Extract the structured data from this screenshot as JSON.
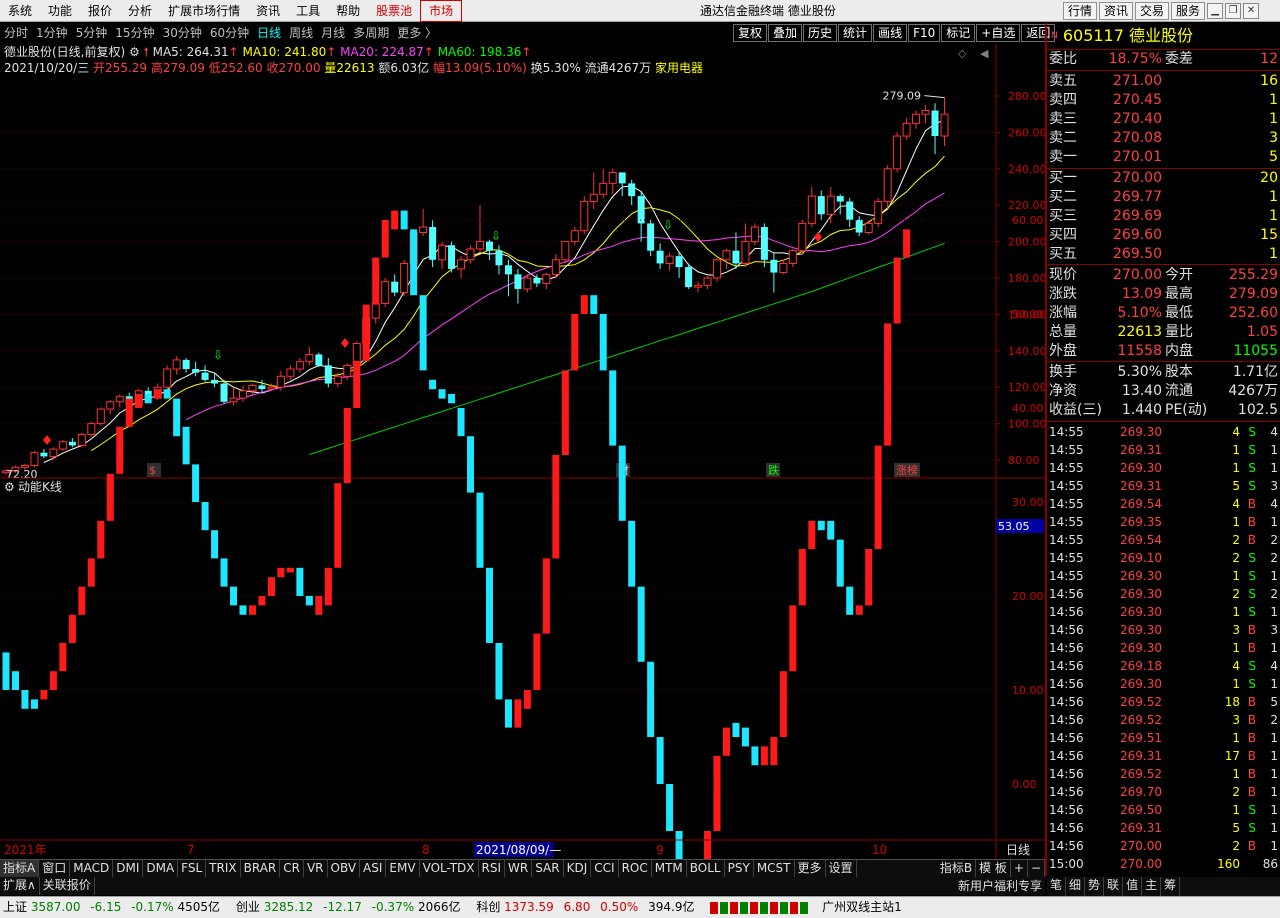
{
  "menu": [
    "系统",
    "功能",
    "报价",
    "分析",
    "扩展市场行情",
    "资讯",
    "工具",
    "帮助",
    "股票池",
    "市场"
  ],
  "app_title": "通达信金融终端  德业股份",
  "right_buttons": [
    "行情",
    "资讯",
    "交易",
    "服务"
  ],
  "periods": [
    "分时",
    "1分钟",
    "5分钟",
    "15分钟",
    "30分钟",
    "60分钟",
    "日线",
    "周线",
    "月线",
    "多周期",
    "更多 〉"
  ],
  "tool_buttons": [
    "复权",
    "叠加",
    "历史",
    "统计",
    "画线",
    "F10",
    "标记",
    "+自选",
    "返回"
  ],
  "info1": {
    "name": "德业股份(日线,前复权)",
    "ma5": "MA5: 264.31",
    "ma10": "MA10: 241.80",
    "ma20": "MA20: 224.87",
    "ma60": "MA60: 198.36"
  },
  "info2": {
    "date": "2021/10/20/三",
    "open": "开255.29",
    "high": "高279.09",
    "low": "低252.60",
    "close": "收270.00",
    "vol": "量22613",
    "amt": "额6.03亿",
    "chg": "幅13.09(5.10%)",
    "turn": "换5.30%",
    "float": "流通4267万",
    "ind": "家用电器"
  },
  "kchart": {
    "y_ticks": [
      "280.00",
      "260.00",
      "240.00",
      "220.00",
      "200.00",
      "180.00",
      "160.00",
      "140.00",
      "120.00",
      "100.00",
      "80.00"
    ],
    "high_label": "279.09",
    "low_label": "72.20",
    "markers": [
      "$",
      "财",
      "跌",
      "涨榜"
    ]
  },
  "indicator": {
    "title": "动能K线",
    "y_ticks": [
      "60.00",
      "50.00",
      "40.00",
      "30.00",
      "20.00",
      "10.00",
      "0.00"
    ],
    "last_value": "53.05"
  },
  "x_axis": {
    "labels": [
      "2021年",
      "7",
      "8",
      "9",
      "10"
    ],
    "cursor_label": "2021/08/09/—",
    "right_label": "日线"
  },
  "stock": {
    "flag": "N",
    "code": "605117",
    "name": "德业股份"
  },
  "weibi": {
    "l1": "委比",
    "v1": "18.75%",
    "l2": "委差",
    "v2": "12"
  },
  "asks": [
    {
      "label": "卖五",
      "price": "271.00",
      "vol": "16"
    },
    {
      "label": "卖四",
      "price": "270.45",
      "vol": "1"
    },
    {
      "label": "卖三",
      "price": "270.40",
      "vol": "1"
    },
    {
      "label": "卖二",
      "price": "270.08",
      "vol": "3"
    },
    {
      "label": "卖一",
      "price": "270.01",
      "vol": "5"
    }
  ],
  "bids": [
    {
      "label": "买一",
      "price": "270.00",
      "vol": "20"
    },
    {
      "label": "买二",
      "price": "269.77",
      "vol": "1"
    },
    {
      "label": "买三",
      "price": "269.69",
      "vol": "1"
    },
    {
      "label": "买四",
      "price": "269.60",
      "vol": "15"
    },
    {
      "label": "买五",
      "price": "269.50",
      "vol": "1"
    }
  ],
  "quote1": [
    {
      "l1": "现价",
      "v1": "270.00",
      "l2": "今开",
      "v2": "255.29"
    },
    {
      "l1": "涨跌",
      "v1": "13.09",
      "l2": "最高",
      "v2": "279.09"
    },
    {
      "l1": "涨幅",
      "v1": "5.10%",
      "l2": "最低",
      "v2": "252.60"
    },
    {
      "l1": "总量",
      "v1": "22613",
      "l2": "量比",
      "v2": "1.05"
    },
    {
      "l1": "外盘",
      "v1": "11558",
      "l2": "内盘",
      "v2": "11055"
    }
  ],
  "quote2": [
    {
      "l1": "换手",
      "v1": "5.30%",
      "l2": "股本",
      "v2": "1.71亿"
    },
    {
      "l1": "净资",
      "v1": "13.40",
      "l2": "流通",
      "v2": "4267万"
    },
    {
      "l1": "收益(三)",
      "v1": "1.440",
      "l2": "PE(动)",
      "v2": "102.5"
    }
  ],
  "ticks": [
    {
      "t": "14:55",
      "p": "269.30",
      "v": "4",
      "s": "S",
      "n": "4"
    },
    {
      "t": "14:55",
      "p": "269.31",
      "v": "1",
      "s": "S",
      "n": "1"
    },
    {
      "t": "14:55",
      "p": "269.30",
      "v": "1",
      "s": "S",
      "n": "1"
    },
    {
      "t": "14:55",
      "p": "269.31",
      "v": "5",
      "s": "S",
      "n": "3"
    },
    {
      "t": "14:55",
      "p": "269.54",
      "v": "4",
      "s": "B",
      "n": "4"
    },
    {
      "t": "14:55",
      "p": "269.35",
      "v": "1",
      "s": "B",
      "n": "1"
    },
    {
      "t": "14:55",
      "p": "269.54",
      "v": "2",
      "s": "B",
      "n": "2"
    },
    {
      "t": "14:55",
      "p": "269.10",
      "v": "2",
      "s": "S",
      "n": "2"
    },
    {
      "t": "14:55",
      "p": "269.30",
      "v": "1",
      "s": "S",
      "n": "1"
    },
    {
      "t": "14:56",
      "p": "269.30",
      "v": "2",
      "s": "S",
      "n": "2"
    },
    {
      "t": "14:56",
      "p": "269.30",
      "v": "1",
      "s": "S",
      "n": "1"
    },
    {
      "t": "14:56",
      "p": "269.30",
      "v": "3",
      "s": "B",
      "n": "3"
    },
    {
      "t": "14:56",
      "p": "269.30",
      "v": "1",
      "s": "B",
      "n": "1"
    },
    {
      "t": "14:56",
      "p": "269.18",
      "v": "4",
      "s": "S",
      "n": "4"
    },
    {
      "t": "14:56",
      "p": "269.30",
      "v": "1",
      "s": "S",
      "n": "1"
    },
    {
      "t": "14:56",
      "p": "269.52",
      "v": "18",
      "s": "B",
      "n": "5"
    },
    {
      "t": "14:56",
      "p": "269.52",
      "v": "3",
      "s": "B",
      "n": "2"
    },
    {
      "t": "14:56",
      "p": "269.51",
      "v": "1",
      "s": "B",
      "n": "1"
    },
    {
      "t": "14:56",
      "p": "269.31",
      "v": "17",
      "s": "B",
      "n": "1"
    },
    {
      "t": "14:56",
      "p": "269.52",
      "v": "1",
      "s": "B",
      "n": "1"
    },
    {
      "t": "14:56",
      "p": "269.70",
      "v": "2",
      "s": "B",
      "n": "1"
    },
    {
      "t": "14:56",
      "p": "269.50",
      "v": "1",
      "s": "S",
      "n": "1"
    },
    {
      "t": "14:56",
      "p": "269.31",
      "v": "5",
      "s": "S",
      "n": "1"
    },
    {
      "t": "14:56",
      "p": "270.00",
      "v": "2",
      "s": "B",
      "n": "1"
    },
    {
      "t": "15:00",
      "p": "270.00",
      "v": "160",
      "s": "",
      "n": "86"
    }
  ],
  "bottom_tabs": [
    "指标A",
    "窗口",
    "MACD",
    "DMI",
    "DMA",
    "FSL",
    "TRIX",
    "BRAR",
    "CR",
    "VR",
    "OBV",
    "ASI",
    "EMV",
    "VOL-TDX",
    "RSI",
    "WR",
    "SAR",
    "KDJ",
    "CCI",
    "ROC",
    "MTM",
    "BOLL",
    "PSY",
    "MCST",
    "更多",
    "设置"
  ],
  "bottom_tabs_right": [
    "指标B",
    "模 板",
    "+",
    "−"
  ],
  "bottom_tabs2": [
    "扩展∧",
    "关联报价"
  ],
  "promo": "新用户福利专享",
  "right_bottom_tabs": [
    "笔",
    "细",
    "势",
    "联",
    "值",
    "主",
    "筹"
  ],
  "status": {
    "sh_label": "上证",
    "sh_val": "3587.00",
    "sh_chg": "-6.15",
    "sh_pct": "-0.17%",
    "sh_amt": "4505亿",
    "cy_label": "创业",
    "cy_val": "3285.12",
    "cy_chg": "-12.17",
    "cy_pct": "-0.37%",
    "cy_amt": "2066亿",
    "kc_label": "科创",
    "kc_val": "1373.59",
    "kc_chg": "6.80",
    "kc_pct": "0.50%",
    "kc_amt": "394.9亿",
    "server": "广州双线主站1"
  },
  "candles": [
    [
      73,
      74,
      75,
      72.2
    ],
    [
      74,
      76,
      77,
      73
    ],
    [
      76,
      77,
      78,
      74.5
    ],
    [
      77,
      84,
      85,
      76
    ],
    [
      84,
      82,
      86,
      81
    ],
    [
      82,
      86,
      87,
      80
    ],
    [
      86,
      90,
      91,
      85
    ],
    [
      90,
      88,
      92,
      87
    ],
    [
      88,
      94,
      95,
      87
    ],
    [
      94,
      100,
      101,
      93
    ],
    [
      100,
      108,
      109,
      99
    ],
    [
      108,
      112,
      113,
      105
    ],
    [
      112,
      115,
      116,
      109
    ],
    [
      115,
      110,
      117,
      108
    ],
    [
      110,
      118,
      119,
      109
    ],
    [
      118,
      114,
      120,
      112
    ],
    [
      114,
      120,
      122,
      113
    ],
    [
      120,
      130,
      132,
      118
    ],
    [
      130,
      135,
      137,
      127
    ],
    [
      135,
      130,
      136,
      128
    ],
    [
      130,
      128,
      134,
      126
    ],
    [
      128,
      124,
      132,
      123
    ],
    [
      124,
      122,
      128,
      120
    ],
    [
      122,
      112,
      124,
      111
    ],
    [
      112,
      114,
      120,
      110
    ],
    [
      114,
      118,
      121,
      112
    ],
    [
      118,
      121,
      122,
      116
    ],
    [
      121,
      119,
      124,
      117
    ],
    [
      119,
      120,
      122,
      118
    ],
    [
      120,
      126,
      129,
      118
    ],
    [
      126,
      130,
      132,
      124
    ],
    [
      130,
      134,
      136,
      128
    ],
    [
      134,
      138,
      142,
      132
    ],
    [
      138,
      132,
      139,
      131
    ],
    [
      132,
      122,
      136,
      120
    ],
    [
      122,
      126,
      128,
      120
    ],
    [
      126,
      132,
      133,
      124
    ],
    [
      132,
      144,
      145,
      130
    ],
    [
      144,
      158,
      160,
      142
    ],
    [
      158,
      166,
      168,
      155
    ],
    [
      166,
      178,
      180,
      164
    ],
    [
      178,
      172,
      182,
      170
    ],
    [
      172,
      188,
      190,
      170
    ],
    [
      188,
      205,
      207,
      186
    ],
    [
      205,
      208,
      218,
      203
    ],
    [
      208,
      190,
      212,
      186
    ],
    [
      190,
      198,
      200,
      185
    ],
    [
      198,
      185,
      200,
      183
    ],
    [
      185,
      190,
      192,
      180
    ],
    [
      190,
      196,
      198,
      188
    ],
    [
      196,
      200,
      220,
      194
    ],
    [
      200,
      195,
      201,
      190
    ],
    [
      195,
      187,
      198,
      182
    ],
    [
      187,
      182,
      190,
      170
    ],
    [
      182,
      174,
      185,
      166
    ],
    [
      174,
      180,
      182,
      172
    ],
    [
      180,
      177,
      182,
      175
    ],
    [
      177,
      182,
      183,
      174
    ],
    [
      182,
      190,
      193,
      180
    ],
    [
      190,
      200,
      200,
      188
    ],
    [
      200,
      206,
      208,
      198
    ],
    [
      206,
      222,
      225,
      204
    ],
    [
      222,
      226,
      238,
      218
    ],
    [
      226,
      232,
      240,
      224
    ],
    [
      232,
      238,
      240,
      226
    ],
    [
      238,
      232,
      238,
      225
    ],
    [
      232,
      225,
      234,
      220
    ],
    [
      225,
      210,
      228,
      200
    ],
    [
      210,
      195,
      212,
      192
    ],
    [
      195,
      188,
      199,
      185
    ],
    [
      188,
      192,
      194,
      184
    ],
    [
      192,
      186,
      194,
      180
    ],
    [
      186,
      175,
      188,
      174
    ],
    [
      175,
      176,
      178,
      172
    ],
    [
      176,
      180,
      181,
      174
    ],
    [
      180,
      190,
      191,
      178
    ],
    [
      190,
      195,
      196,
      185
    ],
    [
      195,
      188,
      205,
      185
    ],
    [
      188,
      200,
      210,
      186
    ],
    [
      200,
      208,
      210,
      198
    ],
    [
      208,
      190,
      210,
      186
    ],
    [
      190,
      183,
      194,
      172
    ],
    [
      183,
      188,
      190,
      182
    ],
    [
      188,
      195,
      196,
      186
    ],
    [
      195,
      210,
      212,
      193
    ],
    [
      210,
      225,
      230,
      208
    ],
    [
      225,
      215,
      228,
      212
    ],
    [
      215,
      225,
      230,
      210
    ],
    [
      225,
      222,
      226,
      215
    ],
    [
      222,
      212,
      224,
      208
    ],
    [
      212,
      205,
      214,
      203
    ],
    [
      205,
      210,
      212,
      204
    ],
    [
      210,
      222,
      224,
      208
    ],
    [
      222,
      240,
      242,
      218
    ],
    [
      240,
      258,
      260,
      238
    ],
    [
      258,
      265,
      268,
      256
    ],
    [
      265,
      270,
      272,
      262
    ],
    [
      270,
      272,
      275,
      265
    ],
    [
      272,
      258,
      276,
      248
    ],
    [
      258,
      270,
      279.09,
      252.6
    ]
  ],
  "dk": [
    [
      14,
      10,
      "c"
    ],
    [
      12,
      10,
      "c"
    ],
    [
      10,
      8,
      "c"
    ],
    [
      9,
      8,
      "c"
    ],
    [
      10,
      9,
      "r"
    ],
    [
      12,
      10,
      "r"
    ],
    [
      15,
      12,
      "r"
    ],
    [
      18,
      15,
      "r"
    ],
    [
      21,
      18,
      "r"
    ],
    [
      24,
      21,
      "r"
    ],
    [
      28,
      24,
      "r"
    ],
    [
      33,
      28,
      "r"
    ],
    [
      38,
      33,
      "r"
    ],
    [
      41,
      38,
      "r"
    ],
    [
      41.5,
      40,
      "r"
    ],
    [
      41.5,
      40.5,
      "c"
    ],
    [
      42,
      41,
      "r"
    ],
    [
      42,
      41,
      "c"
    ],
    [
      41,
      37,
      "c"
    ],
    [
      38,
      34,
      "c"
    ],
    [
      34,
      30,
      "c"
    ],
    [
      30,
      27,
      "c"
    ],
    [
      27,
      24,
      "c"
    ],
    [
      24,
      21,
      "c"
    ],
    [
      21,
      19,
      "c"
    ],
    [
      19,
      18,
      "c"
    ],
    [
      19,
      18,
      "r"
    ],
    [
      20,
      19,
      "r"
    ],
    [
      22,
      20,
      "r"
    ],
    [
      23,
      22,
      "r"
    ],
    [
      23,
      22.5,
      "r"
    ],
    [
      23,
      20,
      "c"
    ],
    [
      20,
      19,
      "c"
    ],
    [
      20,
      18,
      "r"
    ],
    [
      23,
      19,
      "r"
    ],
    [
      32,
      23,
      "r"
    ],
    [
      40,
      32,
      "r"
    ],
    [
      45,
      40,
      "r"
    ],
    [
      51,
      45,
      "r"
    ],
    [
      56,
      51,
      "r"
    ],
    [
      60,
      56,
      "r"
    ],
    [
      61,
      59,
      "r"
    ],
    [
      61,
      59,
      "c"
    ],
    [
      59,
      52,
      "c"
    ],
    [
      52,
      44,
      "c"
    ],
    [
      43,
      42,
      "c"
    ],
    [
      42,
      41,
      "c"
    ],
    [
      41.5,
      40.5,
      "c"
    ],
    [
      40,
      37,
      "c"
    ],
    [
      37,
      31,
      "c"
    ],
    [
      31,
      23,
      "c"
    ],
    [
      23,
      15,
      "c"
    ],
    [
      15,
      9,
      "c"
    ],
    [
      9,
      6,
      "c"
    ],
    [
      9,
      6,
      "r"
    ],
    [
      10,
      8,
      "r"
    ],
    [
      16,
      10,
      "r"
    ],
    [
      24,
      16,
      "r"
    ],
    [
      35,
      24,
      "r"
    ],
    [
      44,
      35,
      "r"
    ],
    [
      50,
      44,
      "r"
    ],
    [
      52,
      50,
      "r"
    ],
    [
      52,
      50,
      "c"
    ],
    [
      50,
      44,
      "c"
    ],
    [
      44,
      36,
      "c"
    ],
    [
      36,
      28,
      "c"
    ],
    [
      28,
      21,
      "c"
    ],
    [
      21,
      13,
      "c"
    ],
    [
      13,
      5,
      "c"
    ],
    [
      5,
      0,
      "c"
    ],
    [
      0,
      -5,
      "c"
    ],
    [
      -5,
      -10,
      "c"
    ],
    [
      -10,
      -11,
      "c"
    ],
    [
      -10,
      -11,
      "r"
    ],
    [
      -5,
      -10,
      "r"
    ],
    [
      3,
      -5,
      "r"
    ],
    [
      6,
      3,
      "r"
    ],
    [
      6.5,
      5,
      "c"
    ],
    [
      6,
      4,
      "c"
    ],
    [
      4,
      2,
      "c"
    ],
    [
      4,
      2,
      "r"
    ],
    [
      5,
      2,
      "r"
    ],
    [
      12,
      5,
      "r"
    ],
    [
      19,
      12,
      "r"
    ],
    [
      25,
      19,
      "r"
    ],
    [
      28,
      25,
      "r"
    ],
    [
      28,
      27,
      "c"
    ],
    [
      28,
      26,
      "c"
    ],
    [
      26,
      21,
      "c"
    ],
    [
      21,
      18,
      "c"
    ],
    [
      19,
      18,
      "r"
    ],
    [
      25,
      19,
      "r"
    ],
    [
      36,
      25,
      "r"
    ],
    [
      49,
      36,
      "r"
    ],
    [
      56,
      49,
      "r"
    ],
    [
      59,
      56,
      "r"
    ]
  ]
}
